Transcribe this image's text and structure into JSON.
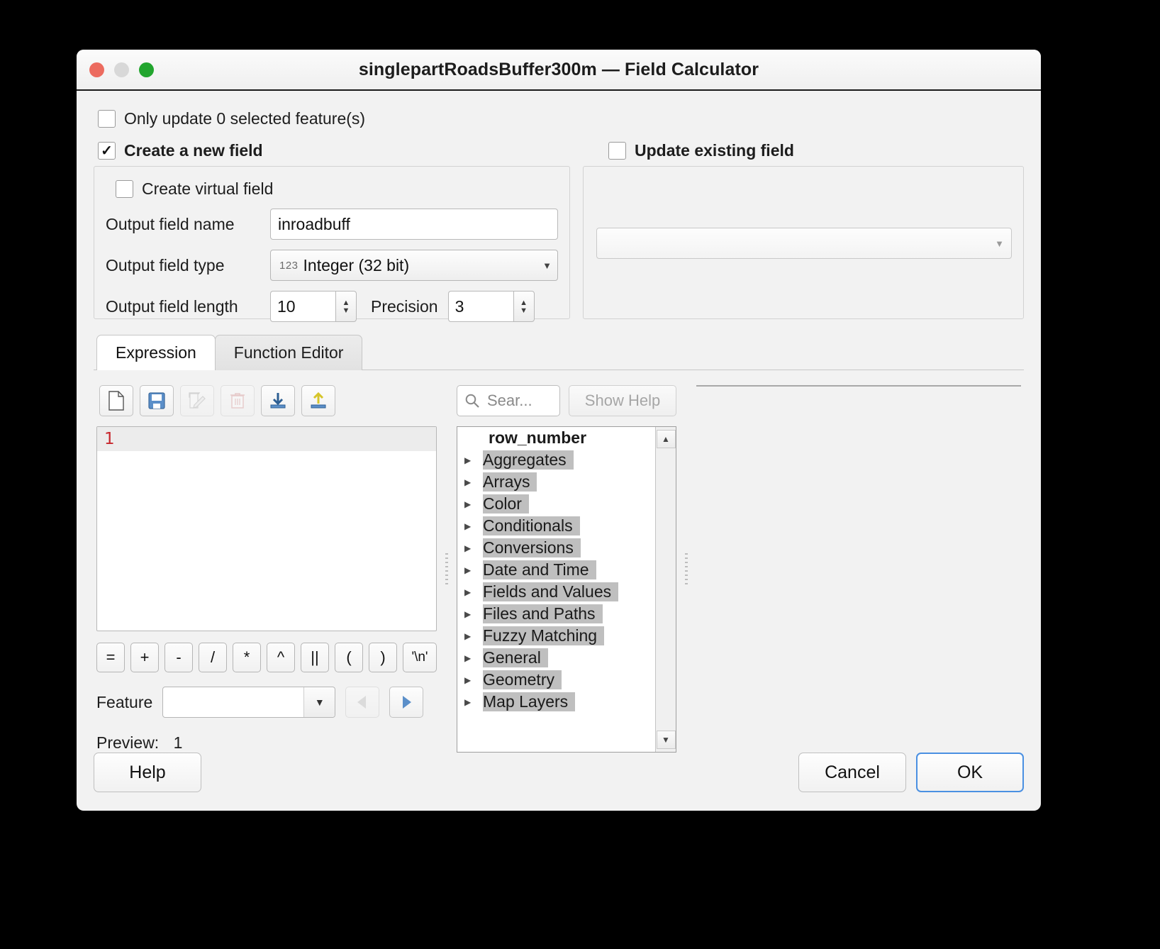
{
  "window": {
    "title": "singlepartRoadsBuffer300m — Field Calculator",
    "traffic": {
      "close": "close-button",
      "minimize": "minimize-button",
      "zoom": "zoom-button"
    }
  },
  "only_update": {
    "label": "Only update 0 selected feature(s)",
    "checked": false
  },
  "create_new_field": {
    "label": "Create a new field",
    "checked": true,
    "virtual_field_label": "Create virtual field",
    "virtual_field_checked": false,
    "output_field_name_label": "Output field name",
    "output_field_name_value": "inroadbuff",
    "output_field_type_label": "Output field type",
    "output_field_type_value": "Integer (32 bit)",
    "output_field_type_icon": "123",
    "output_field_length_label": "Output field length",
    "output_field_length_value": "10",
    "precision_label": "Precision",
    "precision_value": "3"
  },
  "update_existing_field": {
    "label": "Update existing field",
    "checked": false,
    "field_value": ""
  },
  "tabs": [
    {
      "label": "Expression",
      "active": true
    },
    {
      "label": "Function Editor",
      "active": false
    }
  ],
  "toolbar": [
    {
      "name": "new-expression-icon",
      "enabled": true
    },
    {
      "name": "save-expression-icon",
      "enabled": true
    },
    {
      "name": "edit-expression-icon",
      "enabled": false
    },
    {
      "name": "delete-expression-icon",
      "enabled": false
    },
    {
      "name": "import-expression-icon",
      "enabled": true
    },
    {
      "name": "export-expression-icon",
      "enabled": true
    }
  ],
  "editor": {
    "line_number": "1",
    "content": ""
  },
  "operators": [
    "=",
    "+",
    "-",
    "/",
    "*",
    "^",
    "||",
    "(",
    ")",
    "'\\n'"
  ],
  "feature": {
    "label": "Feature",
    "value": "",
    "prev": "◀",
    "next": "▶"
  },
  "preview": {
    "label": "Preview:",
    "value": "1"
  },
  "search": {
    "placeholder": "Sear...",
    "value": "",
    "icon": "search-icon"
  },
  "show_help": {
    "label": "Show Help",
    "enabled": false
  },
  "function_tree": {
    "header": "row_number",
    "items": [
      "Aggregates",
      "Arrays",
      "Color",
      "Conditionals",
      "Conversions",
      "Date and Time",
      "Fields and Values",
      "Files and Paths",
      "Fuzzy Matching",
      "General",
      "Geometry",
      "Map Layers"
    ]
  },
  "help_panel": {
    "content": ""
  },
  "footer": {
    "help_label": "Help",
    "cancel_label": "Cancel",
    "ok_label": "OK"
  },
  "colors": {
    "accent": "#4a90e2",
    "line_number": "#c7262c",
    "selection": "#bfbfbf",
    "close": "#ec6b5f",
    "zoom": "#22a52e"
  }
}
